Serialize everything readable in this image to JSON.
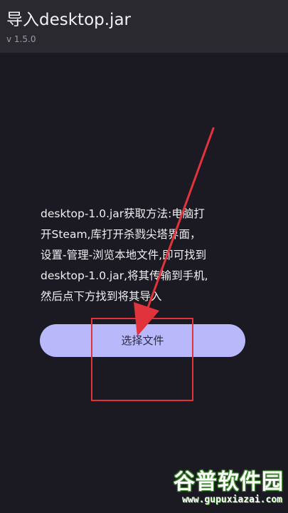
{
  "app_bar": {
    "title": "导入desktop.jar",
    "version": "v 1.5.0"
  },
  "instructions": {
    "lines": [
      "desktop-1.0.jar获取方法:电脑打",
      "开Steam,库打开杀戮尖塔界面，",
      "设置-管理-浏览本地文件,即可找到",
      "desktop-1.0.jar,将其传输到手机,",
      "然后点下方找到将其导入"
    ]
  },
  "select_file_button": {
    "label": "选择文件"
  },
  "annotation": {
    "color": "#e0333b"
  },
  "watermark": {
    "name": "谷普软件园",
    "url": "www.gupuxiazai.com"
  },
  "colors": {
    "background": "#1b1a22",
    "app_bar": "#2a2930",
    "button": "#b9b8fa",
    "watermark_green": "#3f8f2c"
  }
}
